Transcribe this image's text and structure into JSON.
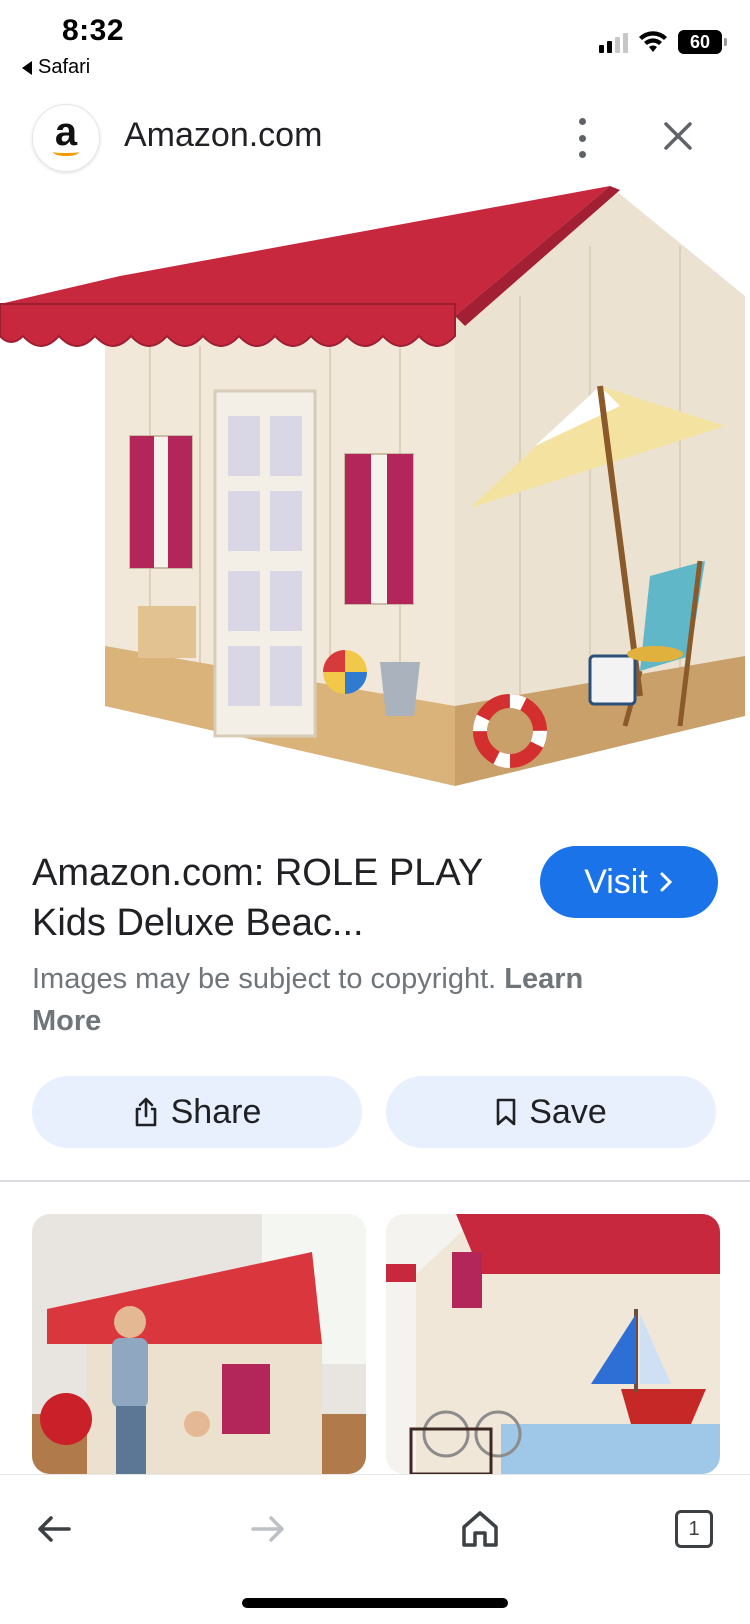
{
  "status_bar": {
    "time": "8:32",
    "back_app": "Safari",
    "battery": "60"
  },
  "header": {
    "logo_letter": "a",
    "site_title": "Amazon.com",
    "menu_icon": "more-vert-icon",
    "close_icon": "close-icon"
  },
  "result": {
    "title": "Amazon.com: ROLE PLAY Kids Deluxe Beac...",
    "visit_label": "Visit",
    "copyright_text": "Images may be subject to copyright.",
    "learn_more": "Learn More"
  },
  "actions": {
    "share_label": "Share",
    "save_label": "Save"
  },
  "toolbar": {
    "tab_count": "1"
  },
  "colors": {
    "accent": "#1a73e8",
    "chip_bg": "#e8f0fe",
    "roof": "#c8283e"
  }
}
